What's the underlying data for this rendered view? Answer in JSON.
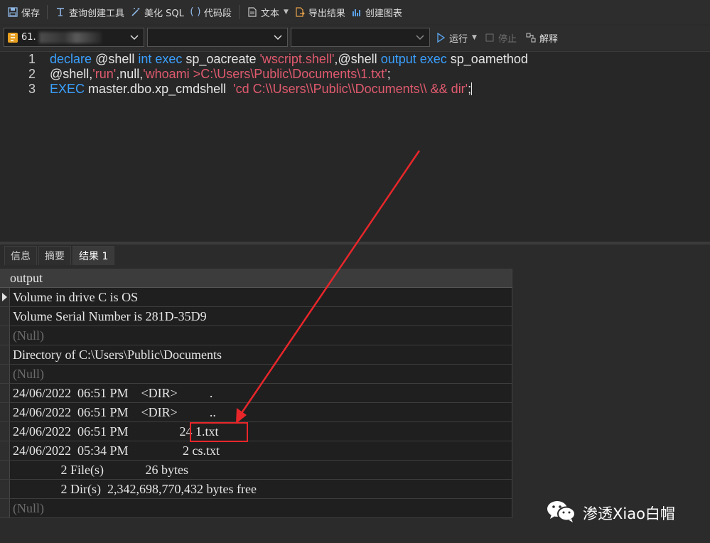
{
  "toolbar": {
    "save": "保存",
    "query_builder": "查询创建工具",
    "beautify_sql": "美化 SQL",
    "snippet": "代码段",
    "text": "文本",
    "export_results": "导出结果",
    "create_chart": "创建图表"
  },
  "connection_bar": {
    "connection_prefix": "61.",
    "database": "",
    "schema": "",
    "run": "运行",
    "stop": "停止",
    "explain": "解释"
  },
  "editor": {
    "line_numbers": [
      "1",
      "2",
      "3"
    ]
  },
  "tabs": {
    "info": "信息",
    "summary": "摘要",
    "result1": "结果 1"
  },
  "grid": {
    "column": "output",
    "rows": [
      "Volume in drive C is OS",
      "Volume Serial Number is 281D-35D9",
      "(Null)",
      "Directory of C:\\Users\\Public\\Documents",
      "(Null)",
      "24/06/2022  06:51 PM    <DIR>          .",
      "24/06/2022  06:51 PM    <DIR>          ..",
      "24/06/2022  06:51 PM                24 1.txt",
      "24/06/2022  05:34 PM                 2 cs.txt",
      "               2 File(s)             26 bytes",
      "               2 Dir(s)  2,342,698,770,432 bytes free",
      "(Null)"
    ]
  },
  "watermark": {
    "text": "渗透Xiao白帽"
  },
  "colors": {
    "keyword": "#3aa0ff",
    "string": "#e05a6e",
    "highlight": "#e8262a"
  }
}
